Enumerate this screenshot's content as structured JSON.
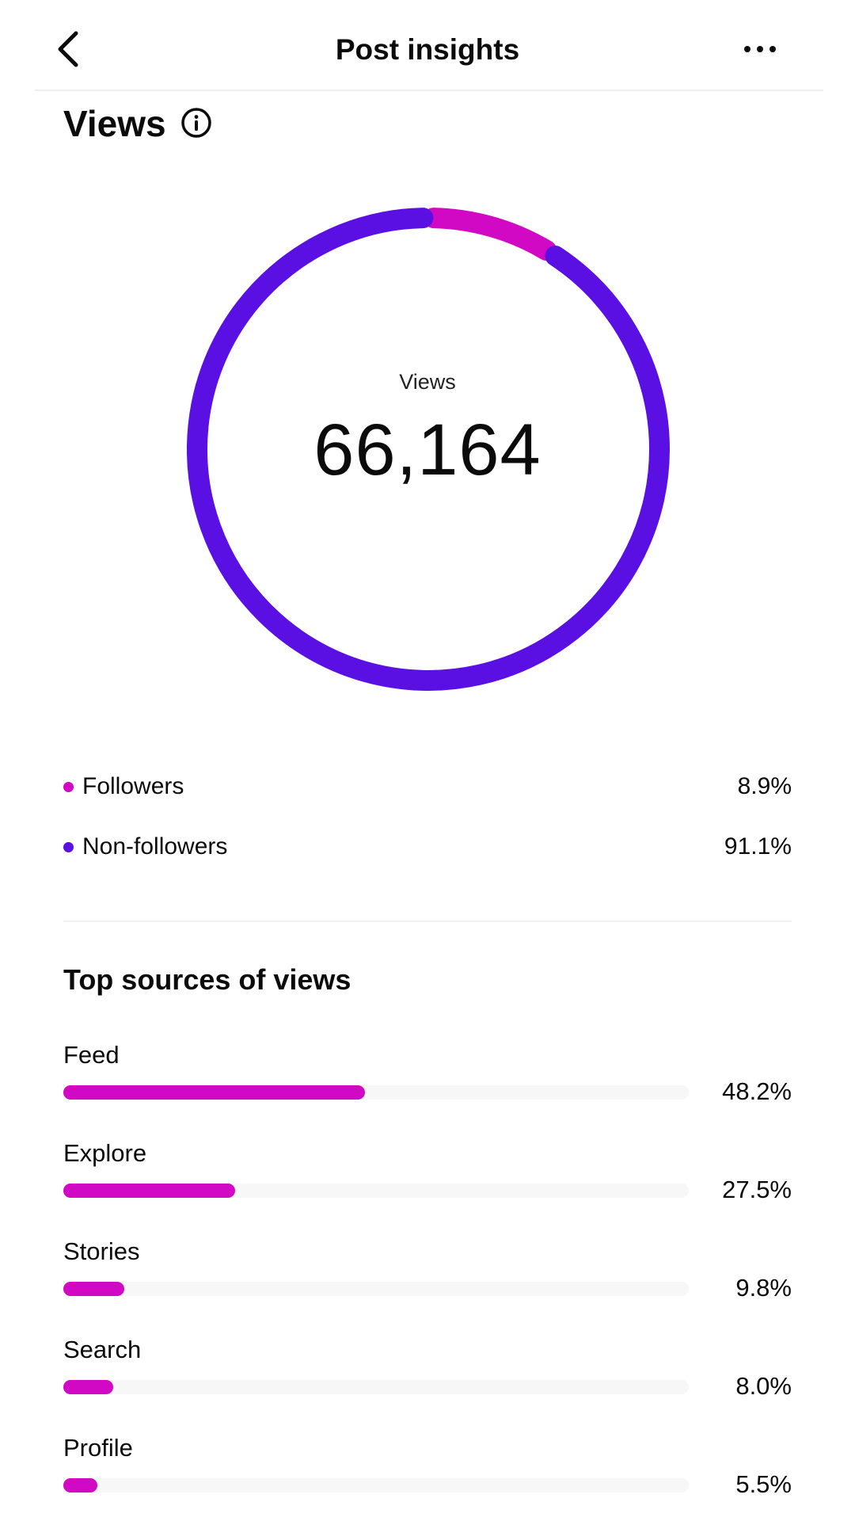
{
  "header": {
    "title": "Post insights",
    "back_icon": "chevron-left-icon",
    "more_icon": "more-horizontal-icon"
  },
  "section": {
    "title": "Views",
    "info_icon": "info-icon"
  },
  "donut": {
    "center_label": "Views",
    "center_value": "66,164",
    "segments": [
      {
        "name": "Followers",
        "percent": 8.9,
        "color": "#d109c4"
      },
      {
        "name": "Non-followers",
        "percent": 91.1,
        "color": "#5a10e3"
      }
    ]
  },
  "legend": [
    {
      "label": "Followers",
      "value": "8.9%",
      "color": "#d109c4"
    },
    {
      "label": "Non-followers",
      "value": "91.1%",
      "color": "#5a10e3"
    }
  ],
  "sources": {
    "title": "Top sources of views",
    "items": [
      {
        "label": "Feed",
        "value": "48.2%",
        "percent": 48.2
      },
      {
        "label": "Explore",
        "value": "27.5%",
        "percent": 27.5
      },
      {
        "label": "Stories",
        "value": "9.8%",
        "percent": 9.8
      },
      {
        "label": "Search",
        "value": "8.0%",
        "percent": 8.0
      },
      {
        "label": "Profile",
        "value": "5.5%",
        "percent": 5.5
      }
    ]
  }
}
